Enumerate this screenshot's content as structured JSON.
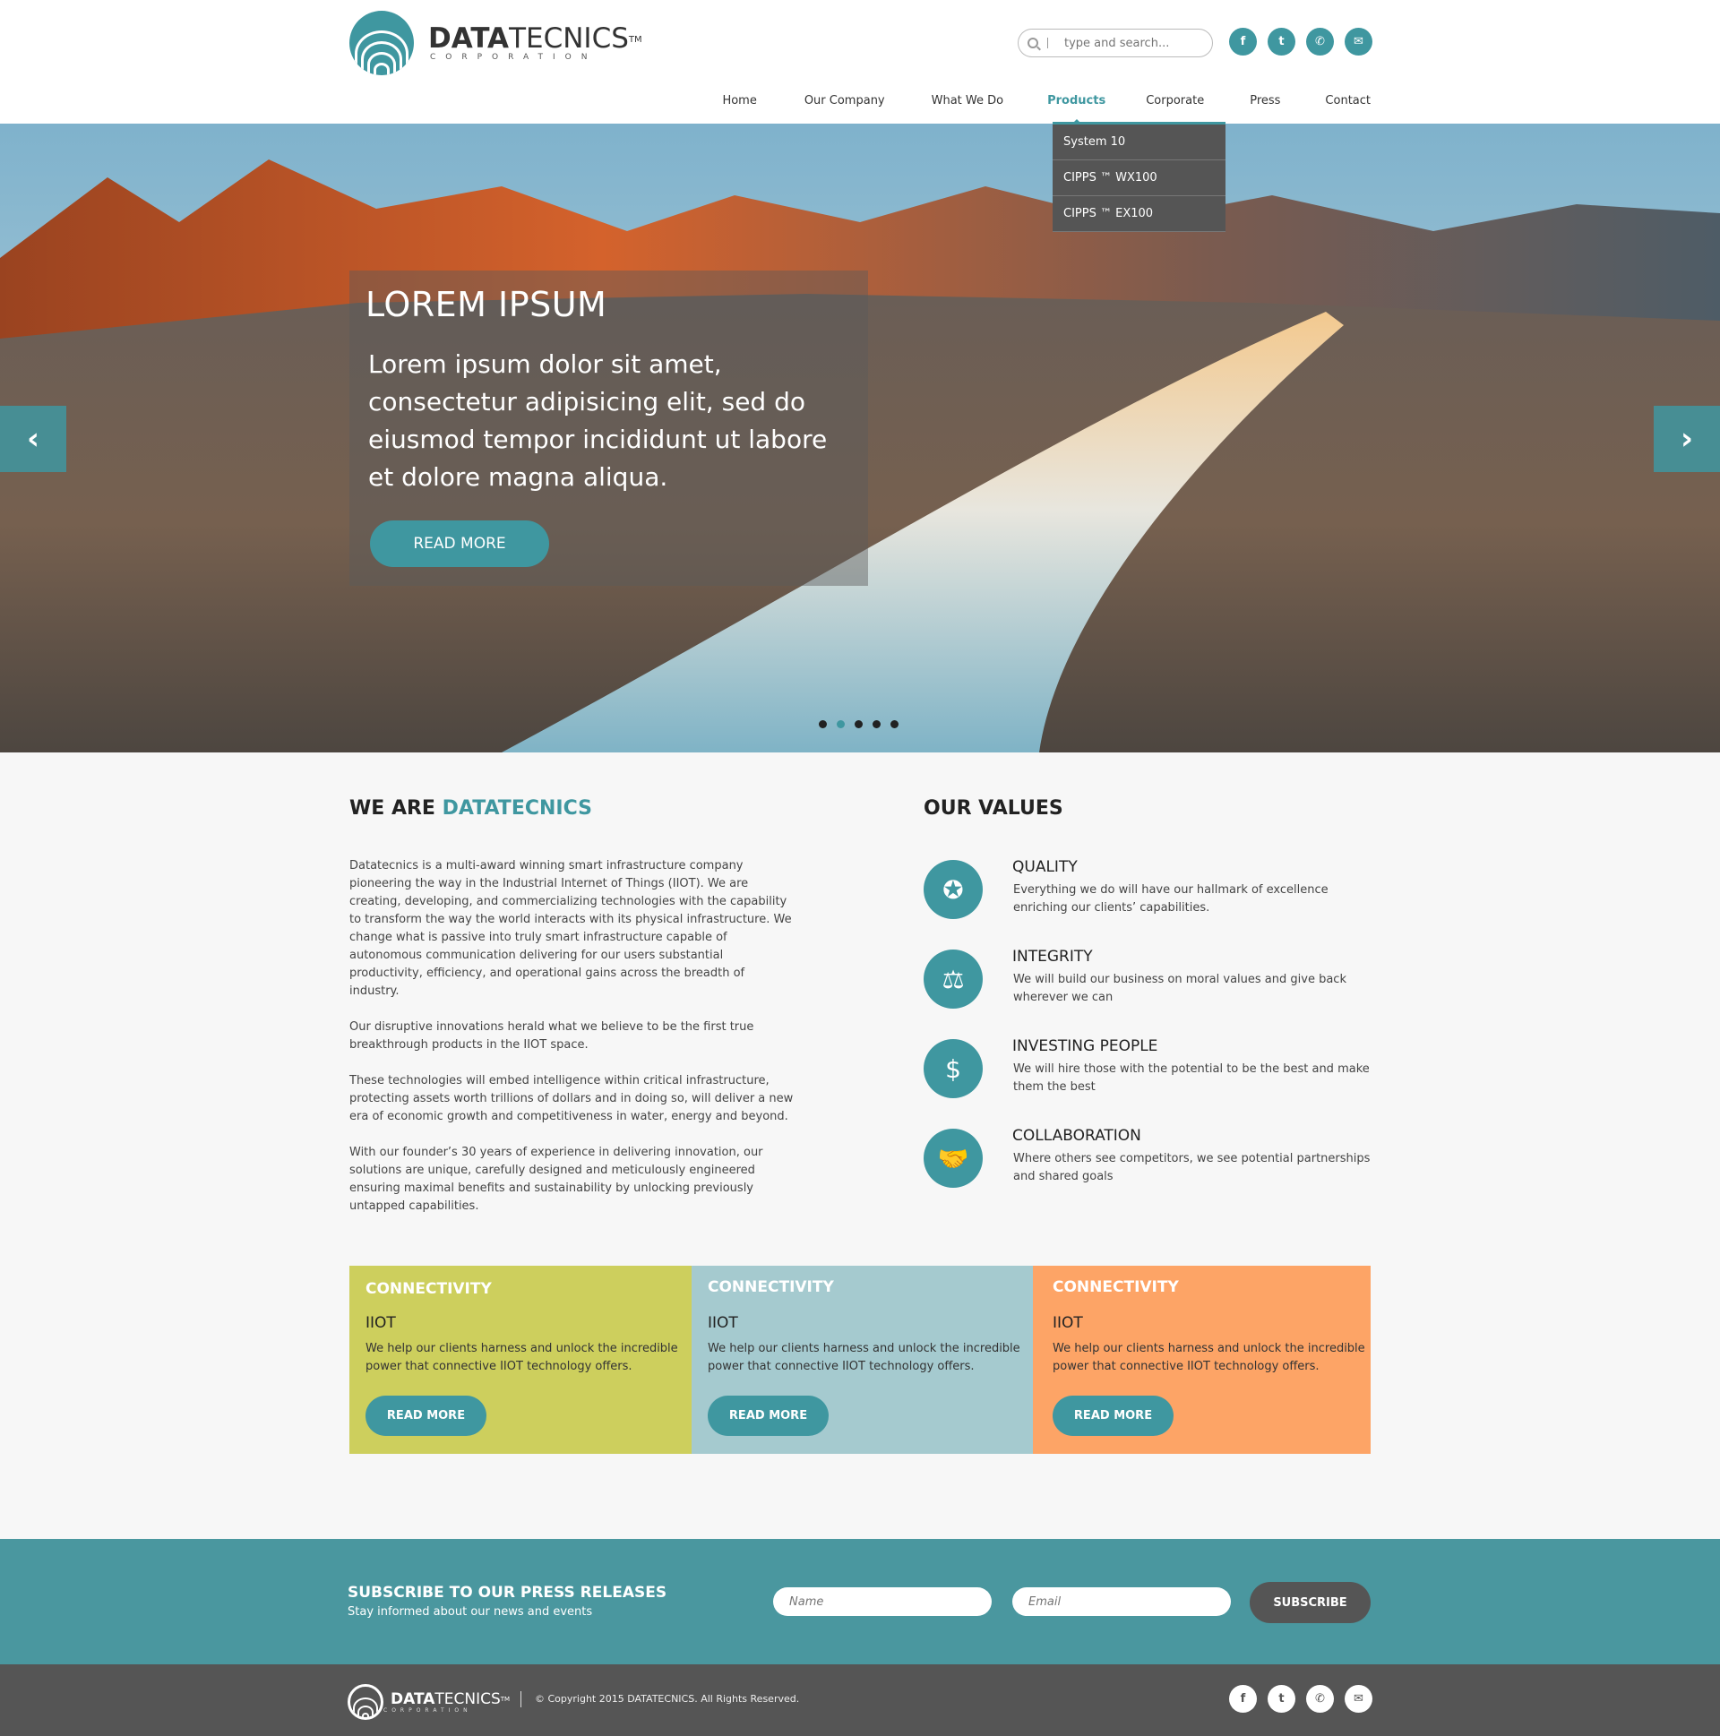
{
  "header": {
    "logo": {
      "name_bold": "DATA",
      "name_light": "TECNICS",
      "tm": "TM",
      "sub": "CORPORATION"
    },
    "search_placeholder": "type and search...",
    "socials": [
      {
        "icon": "facebook-icon",
        "glyph": "f"
      },
      {
        "icon": "twitter-icon",
        "glyph": "t"
      },
      {
        "icon": "phone-icon",
        "glyph": "✆"
      },
      {
        "icon": "mail-icon",
        "glyph": "✉"
      }
    ]
  },
  "nav": {
    "items": [
      {
        "label": "Home"
      },
      {
        "label": "Our Company"
      },
      {
        "label": "What We Do"
      },
      {
        "label": "Products"
      },
      {
        "label": "Corporate"
      },
      {
        "label": "Press"
      },
      {
        "label": "Contact"
      }
    ],
    "active": "Products",
    "dropdown": [
      "System 10",
      "CIPPS ™ WX100",
      "CIPPS ™ EX100"
    ]
  },
  "hero": {
    "title": "LOREM IPSUM",
    "text": "Lorem ipsum dolor sit amet, consectetur adipisicing elit, sed do eiusmod tempor incididunt ut labore et dolore magna aliqua.",
    "button": "READ MORE",
    "prev": "‹",
    "next": "›",
    "slides": 5,
    "active_slide": 2
  },
  "about": {
    "heading_pre": "WE ARE ",
    "heading_accent": "DATATECNICS",
    "paragraphs": [
      "Datatecnics is a multi-award winning smart infrastructure company pioneering the way in the Industrial Internet of Things (IIOT). We are creating, developing, and commercializing technologies with the capability to transform the way the world interacts with its physical infrastructure. We change what is passive into truly smart infrastructure capable of autonomous communication delivering for our users substantial productivity, efficiency, and operational gains across the breadth of industry.",
      "Our disruptive innovations herald what we believe to be the first true breakthrough products in the IIOT space.",
      "These technologies will embed intelligence within critical infrastructure, protecting assets worth trillions of dollars and in doing so, will deliver a new era of economic growth and competitiveness in water, energy and beyond.",
      "With our founder’s 30 years of experience in delivering innovation, our solutions are unique, carefully designed and meticulously engineered ensuring maximal benefits and sustainability by unlocking previously untapped capabilities."
    ]
  },
  "values": {
    "heading": "OUR VALUES",
    "items": [
      {
        "icon": "award-icon",
        "glyph": "✪",
        "title": "QUALITY",
        "desc": "Everything we do will have our hallmark of excellence enriching our clients’ capabilities."
      },
      {
        "icon": "scales-icon",
        "glyph": "⚖",
        "title": "INTEGRITY",
        "desc": "We will build our business on moral values and give back wherever we can"
      },
      {
        "icon": "investor-icon",
        "glyph": "$",
        "title": "INVESTING PEOPLE",
        "desc": "We will hire those with the potential to be the best and make them the best"
      },
      {
        "icon": "handshake-icon",
        "glyph": "🤝",
        "title": "COLLABORATION",
        "desc": "Where others see competitors, we see potential partnerships and shared goals"
      }
    ]
  },
  "tiles": [
    {
      "heading": "CONNECTIVITY",
      "sub": "IIOT",
      "desc": "We help our clients harness and unlock the incredible power that connective IIOT technology offers.",
      "button": "READ MORE",
      "color": "#cdcf5d"
    },
    {
      "heading": "CONNECTIVITY",
      "sub": "IIOT",
      "desc": "We help our clients harness and unlock the incredible power that connective IIOT technology offers.",
      "button": "READ MORE",
      "color": "#a5cacf"
    },
    {
      "heading": "CONNECTIVITY",
      "sub": "IIOT",
      "desc": "We help our clients harness and unlock the incredible power that connective IIOT technology offers.",
      "button": "READ MORE",
      "color": "#fda466"
    }
  ],
  "subscribe": {
    "heading": "SUBSCRIBE TO OUR PRESS RELEASES",
    "sub": "Stay informed about our news and events",
    "name_placeholder": "Name",
    "email_placeholder": "Email",
    "button": "SUBSCRIBE"
  },
  "footer": {
    "logo": {
      "name_bold": "DATA",
      "name_light": "TECNICS",
      "tm": "TM",
      "sub": "CORPORATION"
    },
    "copyright": "© Copyright 2015 DATATECNICS. All Rights Reserved."
  },
  "colors": {
    "accent": "#3f97a0",
    "dark": "#555555",
    "subscribe_bg": "#4a979f"
  }
}
